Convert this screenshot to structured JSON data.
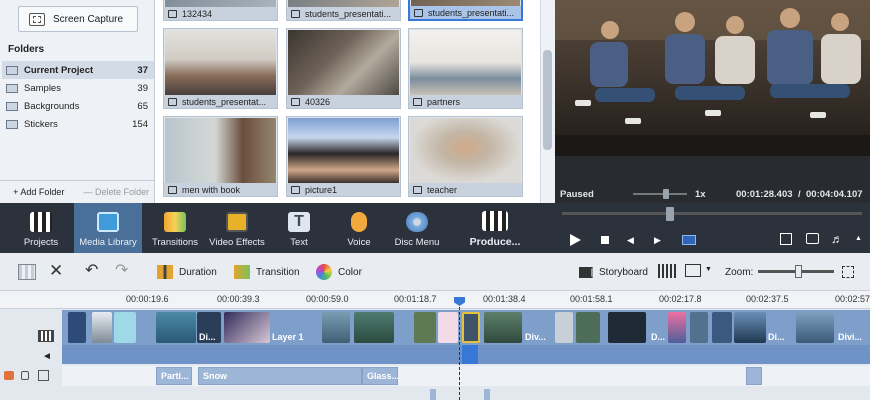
{
  "left_panel": {
    "screen_capture": "Screen Capture",
    "folders_title": "Folders",
    "folders": [
      {
        "name": "Current Project",
        "count": "37",
        "selected": true
      },
      {
        "name": "Samples",
        "count": "39"
      },
      {
        "name": "Backgrounds",
        "count": "65"
      },
      {
        "name": "Stickers",
        "count": "154"
      }
    ],
    "add_folder": "+ Add Folder",
    "delete_folder": "— Delete Folder"
  },
  "media": {
    "items": [
      {
        "label": "132434"
      },
      {
        "label": "students_presentati..."
      },
      {
        "label": "students_presentati...",
        "selected": true
      },
      {
        "label": "students_presentat..."
      },
      {
        "label": "40326"
      },
      {
        "label": "partners"
      },
      {
        "label": "men with book"
      },
      {
        "label": "picture1"
      },
      {
        "label": "teacher"
      }
    ]
  },
  "preview": {
    "status": "Paused",
    "speed": "1x",
    "current_time": "00:01:28.403",
    "total_time": "00:04:04.107"
  },
  "toolbar": {
    "items": [
      "Projects",
      "Media Library",
      "Transitions",
      "Video Effects",
      "Text",
      "Voice",
      "Disc Menu",
      "Produce..."
    ],
    "active": "Media Library"
  },
  "editor_toolbar": {
    "duration": "Duration",
    "transition": "Transition",
    "color": "Color",
    "storyboard": "Storyboard",
    "zoom": "Zoom:",
    "zoom_level": 0.6
  },
  "timeline": {
    "ticks": [
      "00:00:19.6",
      "00:00:39.3",
      "00:00:59.0",
      "00:01:18.7",
      "00:01:38.4",
      "00:01:58.1",
      "00:02:17.8",
      "00:02:37.5",
      "00:02:57"
    ],
    "clip_labels": [
      "Di...",
      "Layer 1",
      "Div...",
      "D...",
      "Di...",
      "Divi..."
    ],
    "effects": [
      "Parti...",
      "Snow",
      "Glass..."
    ]
  },
  "colors": {
    "accent": "#3778d6",
    "toolbar_bg": "#2c323b",
    "track": "#7f9fcb"
  }
}
